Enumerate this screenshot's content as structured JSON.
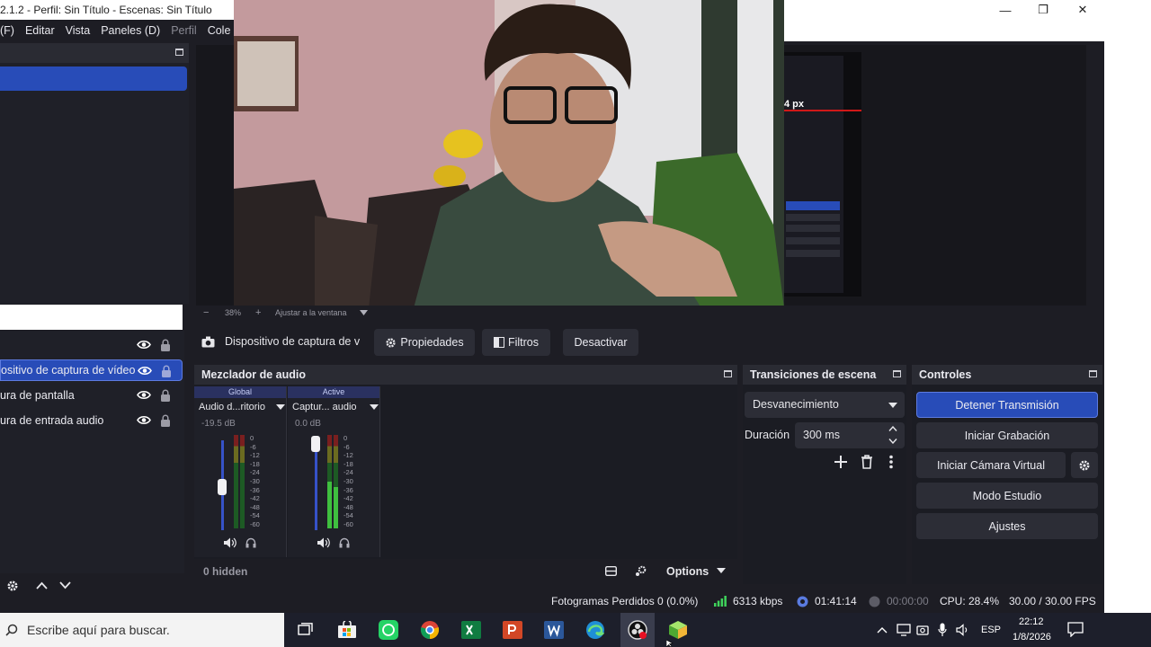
{
  "window": {
    "title": "2.1.2 - Perfil: Sin Título - Escenas: Sin Título",
    "minimize": "—",
    "maximize": "❐",
    "close": "✕"
  },
  "menu": [
    "(F)",
    "Editar",
    "Vista",
    "Paneles (D)",
    "Perfil",
    "Cole"
  ],
  "preview": {
    "zoom": "38%",
    "fit_label": "Ajustar a la ventana",
    "overlay_text": "4 px"
  },
  "sources": {
    "items": [
      {
        "label": "",
        "selected": false
      },
      {
        "label": "ositivo de captura de vídeo",
        "selected": true
      },
      {
        "label": "ura de pantalla",
        "selected": false
      },
      {
        "label": "ura de entrada audio",
        "selected": false
      }
    ]
  },
  "source_toolbar": {
    "device": "Dispositivo de captura de v",
    "properties": "Propiedades",
    "filters": "Filtros",
    "deactivate": "Desactivar"
  },
  "mixer": {
    "title": "Mezclador de audio",
    "hidden": "0 hidden",
    "options": "Options",
    "channels": [
      {
        "tab": "Global",
        "name": "Audio d...ritorio",
        "db": "-19.5 dB",
        "level": 0.48
      },
      {
        "tab": "Active",
        "name": "Captur... audio",
        "db": "0.0 dB",
        "level": 0.96
      }
    ],
    "ticks": [
      "0",
      "-6",
      "-12",
      "-18",
      "-24",
      "-30",
      "-36",
      "-42",
      "-48",
      "-54",
      "-60"
    ]
  },
  "transitions": {
    "title": "Transiciones de escena",
    "selected": "Desvanecimiento",
    "duration_label": "Duración",
    "duration_value": "300 ms"
  },
  "controls": {
    "title": "Controles",
    "stop_stream": "Detener Transmisión",
    "start_recording": "Iniciar Grabación",
    "start_virtual_cam": "Iniciar Cámara Virtual",
    "studio_mode": "Modo Estudio",
    "settings": "Ajustes"
  },
  "status": {
    "dropped": "Fotogramas Perdidos 0 (0.0%)",
    "bitrate": "6313 kbps",
    "stream_time": "01:41:14",
    "rec_time": "00:00:00",
    "cpu": "CPU: 28.4%",
    "fps": "30.00 / 30.00 FPS"
  },
  "taskbar": {
    "search_placeholder": "Escribe aquí para buscar.",
    "lang": "ESP",
    "time": "22:12",
    "date": "1/8/2026"
  }
}
